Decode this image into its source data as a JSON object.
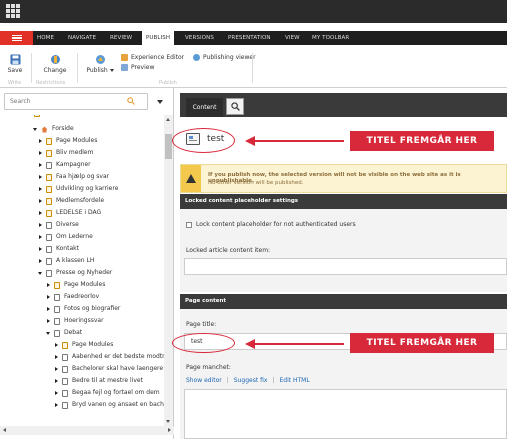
{
  "ribbon_tabs": [
    {
      "label": "HOME"
    },
    {
      "label": "NAVIGATE"
    },
    {
      "label": "REVIEW"
    },
    {
      "label": "PUBLISH"
    },
    {
      "label": "VERSIONS"
    },
    {
      "label": "PRESENTATION"
    },
    {
      "label": "VIEW"
    },
    {
      "label": "MY TOOLBAR"
    }
  ],
  "ribbon": {
    "save_label": "Save",
    "change_label": "Change",
    "publish_label": "Publish",
    "experience_editor_label": "Experience Editor",
    "preview_label": "Preview",
    "publishing_viewer_label": "Publishing viewer",
    "group_write": "Write",
    "group_restrictions": "Restrictions",
    "group_publish": "Publish"
  },
  "search": {
    "placeholder": "Search"
  },
  "tree": {
    "items": [
      {
        "label": "Forside"
      },
      {
        "label": "Page Modules"
      },
      {
        "label": "Bliv medlem"
      },
      {
        "label": "Kampagner"
      },
      {
        "label": "Faa hjælp og svar"
      },
      {
        "label": "Udvikling og karriere"
      },
      {
        "label": "Medlemsfordele"
      },
      {
        "label": "LEDELSE i DAG"
      },
      {
        "label": "Diverse"
      },
      {
        "label": "Om Lederne"
      },
      {
        "label": "Kontakt"
      },
      {
        "label": "A klassen LH"
      },
      {
        "label": "Presse og Nyheder"
      },
      {
        "label": "Page Modules"
      },
      {
        "label": "Faedreorlov"
      },
      {
        "label": "Fotos og biografier"
      },
      {
        "label": "Hoeringssvar"
      },
      {
        "label": "Debat"
      },
      {
        "label": "Page Modules"
      },
      {
        "label": "Aabenhed er det bedste modtra"
      },
      {
        "label": "Bachelorer skal have laengere ti"
      },
      {
        "label": "Bedre til at mestre livet"
      },
      {
        "label": "Begaa fejl og fortael om dem"
      },
      {
        "label": "Bryd vanen og ansaet en bachel"
      }
    ]
  },
  "content": {
    "tab_label": "Content",
    "item_title": "test",
    "warning_line1": "If you publish now, the selected version will not be visible on the web site as it is unpublishable.",
    "warning_line2": "No other version will be published.",
    "section1_title": "Locked content placeholder settings",
    "lock_checkbox_label": "Lock content placeholder for not authenticated users",
    "locked_article_label": "Locked article content item:",
    "section2_title": "Page content",
    "page_title_label": "Page title:",
    "page_title_value": "test",
    "page_manchet_label": "Page manchet:",
    "show_editor": "Show editor",
    "suggest_fix": "Suggest fix",
    "edit_html": "Edit HTML"
  },
  "annotations": {
    "label_top": "TITEL FREMGÅR HER",
    "label_bottom": "TITEL FREMGÅR HER",
    "color": "#d8293a"
  },
  "colors": {
    "accent_red": "#e23127",
    "dark_bar": "#2b2b2b",
    "warning_bg": "#fcf3d2",
    "link": "#1c66b3"
  }
}
